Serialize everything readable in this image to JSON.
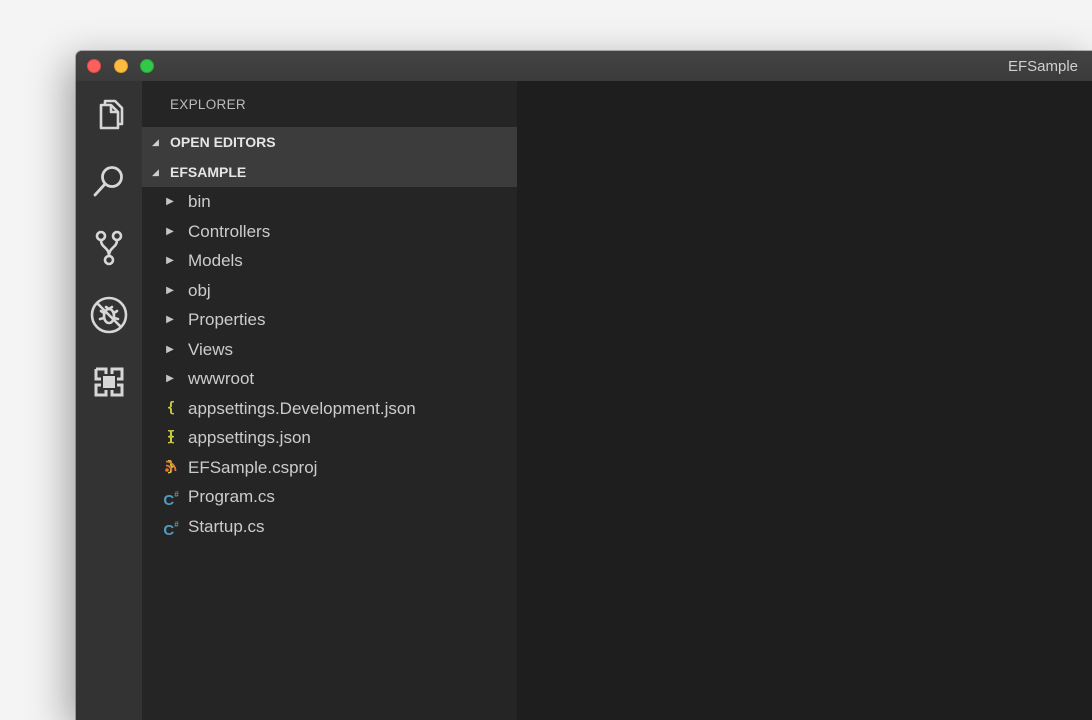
{
  "window": {
    "title": "EFSample"
  },
  "activity_bar": {
    "icons": [
      "files-icon",
      "search-icon",
      "source-control-icon",
      "debug-icon",
      "extensions-icon"
    ]
  },
  "sidebar": {
    "title": "EXPLORER",
    "sections": [
      {
        "label": "OPEN EDITORS",
        "expanded": true
      },
      {
        "label": "EFSAMPLE",
        "expanded": true
      }
    ],
    "tree": [
      {
        "name": "bin",
        "type": "folder"
      },
      {
        "name": "Controllers",
        "type": "folder"
      },
      {
        "name": "Models",
        "type": "folder"
      },
      {
        "name": "obj",
        "type": "folder"
      },
      {
        "name": "Properties",
        "type": "folder"
      },
      {
        "name": "Views",
        "type": "folder"
      },
      {
        "name": "wwwroot",
        "type": "folder"
      },
      {
        "name": "appsettings.Development.json",
        "type": "json"
      },
      {
        "name": "appsettings.json",
        "type": "json"
      },
      {
        "name": "EFSample.csproj",
        "type": "csproj"
      },
      {
        "name": "Program.cs",
        "type": "cs"
      },
      {
        "name": "Startup.cs",
        "type": "cs"
      }
    ],
    "icon_glyphs": {
      "folder": "▶",
      "json": "{ }",
      "csproj": "◣",
      "cs": "C#"
    }
  },
  "colors": {
    "activity_bar": "#333333",
    "sidebar": "#252526",
    "section_header": "#3c3c3c",
    "editor": "#1e1e1e",
    "json_icon": "#cbcb41",
    "csproj_icon": "#e37933",
    "cs_icon": "#519aba"
  }
}
